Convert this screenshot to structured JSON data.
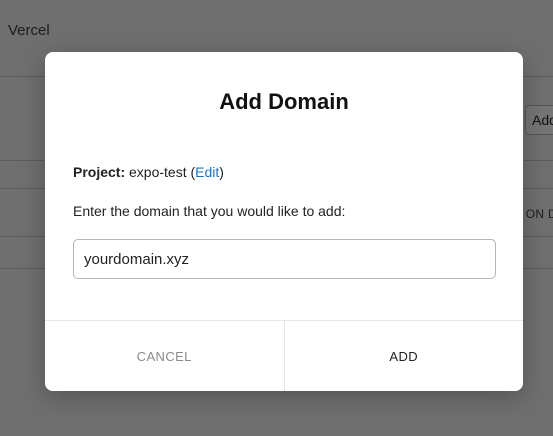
{
  "background": {
    "brand": "Vercel",
    "add_button_label": "Add",
    "side_text": "ON D"
  },
  "modal": {
    "title": "Add Domain",
    "project_label": "Project:",
    "project_name": "expo-test",
    "edit_open_paren": "(",
    "edit_label": "Edit",
    "edit_close_paren": ")",
    "prompt": "Enter the domain that you would like to add:",
    "domain_input_value": "yourdomain.xyz",
    "cancel_label": "CANCEL",
    "add_label": "ADD"
  }
}
